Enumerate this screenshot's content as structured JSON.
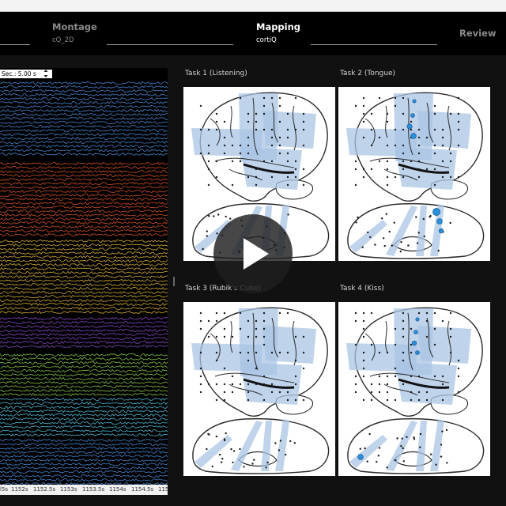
{
  "steps": [
    {
      "label": "",
      "sub": ""
    },
    {
      "label": "Montage",
      "sub": "cQ_2D"
    },
    {
      "label": "Mapping",
      "sub": "cortiQ"
    },
    {
      "label": "Review",
      "sub": ""
    }
  ],
  "eeg": {
    "seconds_label": "Sec.: 5.00 s",
    "ticks": [
      "l5s",
      "1152s",
      "1152.5s",
      "1153s",
      "1153.5s",
      "1154s",
      "1154.5s",
      "115"
    ],
    "trace_groups": [
      {
        "color": "#4f8fe0"
      },
      {
        "color": "#e0552a"
      },
      {
        "color": "#e8b93a"
      },
      {
        "color": "#8f4fd0"
      },
      {
        "color": "#8fd04a"
      },
      {
        "color": "#56c8e8"
      },
      {
        "color": "#4f8fe0"
      }
    ]
  },
  "tasks": [
    {
      "title": "Task 1  (Listening)"
    },
    {
      "title": "Task 2  (Tongue)"
    },
    {
      "title": "Task 3  (Rubik's Cube)"
    },
    {
      "title": "Task 4  (Kiss)"
    }
  ],
  "colors": {
    "grid_fill": "#a9c4e4",
    "electrode": "#1a1a1a",
    "active_electrode": "#2a8fd8"
  },
  "icons": {
    "play": "play-icon",
    "spinner": "spinner-arrows-icon"
  }
}
